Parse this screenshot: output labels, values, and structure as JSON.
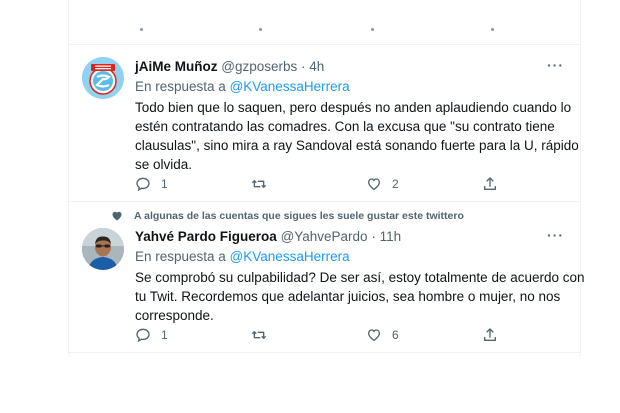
{
  "tweets": [
    {
      "display_name": "jAiMe Muñoz",
      "handle": "@gzposerbs",
      "separator": "·",
      "time": "4h",
      "reply_prefix": "En respuesta a",
      "reply_to": "@KVanessaHerrera",
      "text_lines": [
        "Todo bien que lo saquen, pero después no anden aplaudiendo cuando lo",
        "estén contratando las comadres. Con la excusa que \"su contrato tiene",
        "clausulas\", sino mira a ray Sandoval está sonando fuerte para la U, rápido",
        "se olvida."
      ],
      "reply_count": "1",
      "retweet_count": "",
      "like_count": "2",
      "avatar_icon": "sporting-cristal-crest-icon"
    },
    {
      "social_context": "A algunas de las cuentas que sigues les suele gustar este twittero",
      "display_name": "Yahvé Pardo Figueroa",
      "handle": "@YahvePardo",
      "separator": "·",
      "time": "11h",
      "reply_prefix": "En respuesta a",
      "reply_to": "@KVanessaHerrera",
      "text_lines": [
        "Se comprobó su culpabilidad? De ser así, estoy totalmente de acuerdo con",
        "tu Twit. Recordemos que adelantar juicios, sea hombre o mujer, no nos",
        "corresponde."
      ],
      "reply_count": "1",
      "retweet_count": "",
      "like_count": "6",
      "avatar_icon": "profile-photo"
    }
  ],
  "icons": {
    "more": "more-icon",
    "reply": "reply-icon",
    "retweet": "retweet-icon",
    "like": "heart-icon",
    "share": "share-icon",
    "social": "heart-icon"
  },
  "colors": {
    "link": "#1d9bf0",
    "muted": "#536471",
    "text": "#0f1419",
    "border": "#eff3f4"
  }
}
